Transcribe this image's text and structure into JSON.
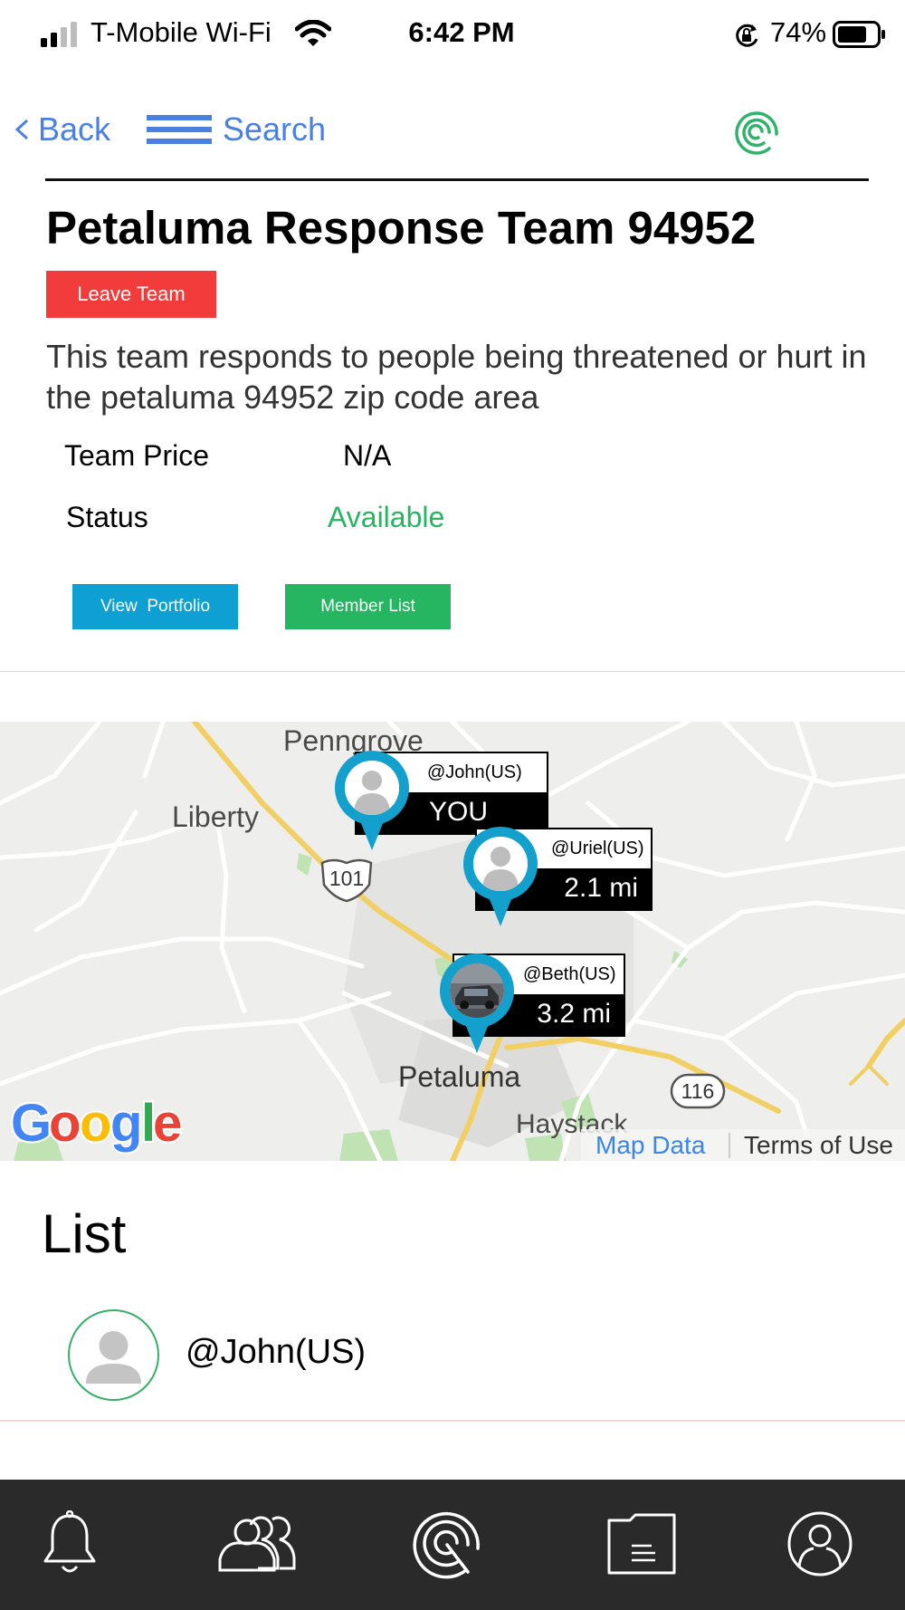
{
  "status_bar": {
    "carrier": "T-Mobile Wi-Fi",
    "time": "6:42 PM",
    "battery": "74%"
  },
  "nav": {
    "back_label": "Back",
    "search_label": "Search"
  },
  "team": {
    "title": "Petaluma Response Team 94952",
    "leave_label": "Leave Team",
    "description": "This team responds to people being threatened or hurt in the petaluma 94952 zip code area",
    "price_label": "Team Price",
    "price_value": "N/A",
    "status_label": "Status",
    "status_value": "Available",
    "status_color": "#26b561",
    "portfolio_label": "View  Portfolio",
    "members_label": "Member List"
  },
  "map": {
    "places": [
      "Penngrove",
      "Liberty",
      "Petaluma",
      "Haystack"
    ],
    "route_shields": [
      "101",
      "116"
    ],
    "pins": [
      {
        "name": "@John(US)",
        "distance": "YOU",
        "photo": "default-avatar"
      },
      {
        "name": "@Uriel(US)",
        "distance": "2.1 mi",
        "photo": "default-avatar"
      },
      {
        "name": "@Beth(US)",
        "distance": "3.2 mi",
        "photo": "car-photo"
      }
    ],
    "map_data_label": "Map Data",
    "terms_label": "Terms of Use",
    "provider": "Google"
  },
  "list": {
    "title": "List",
    "items": [
      {
        "name": "@John(US)"
      }
    ]
  },
  "tabs": [
    "bell-icon",
    "group-icon",
    "radar-icon",
    "folder-icon",
    "profile-icon"
  ],
  "colors": {
    "accent_blue": "#4a80e0",
    "leave_red": "#f23b3b",
    "portfolio_blue": "#0ea0d2",
    "member_green": "#26b561",
    "pin_blue": "#13a0cc",
    "tabbar": "#2a2a2a"
  }
}
